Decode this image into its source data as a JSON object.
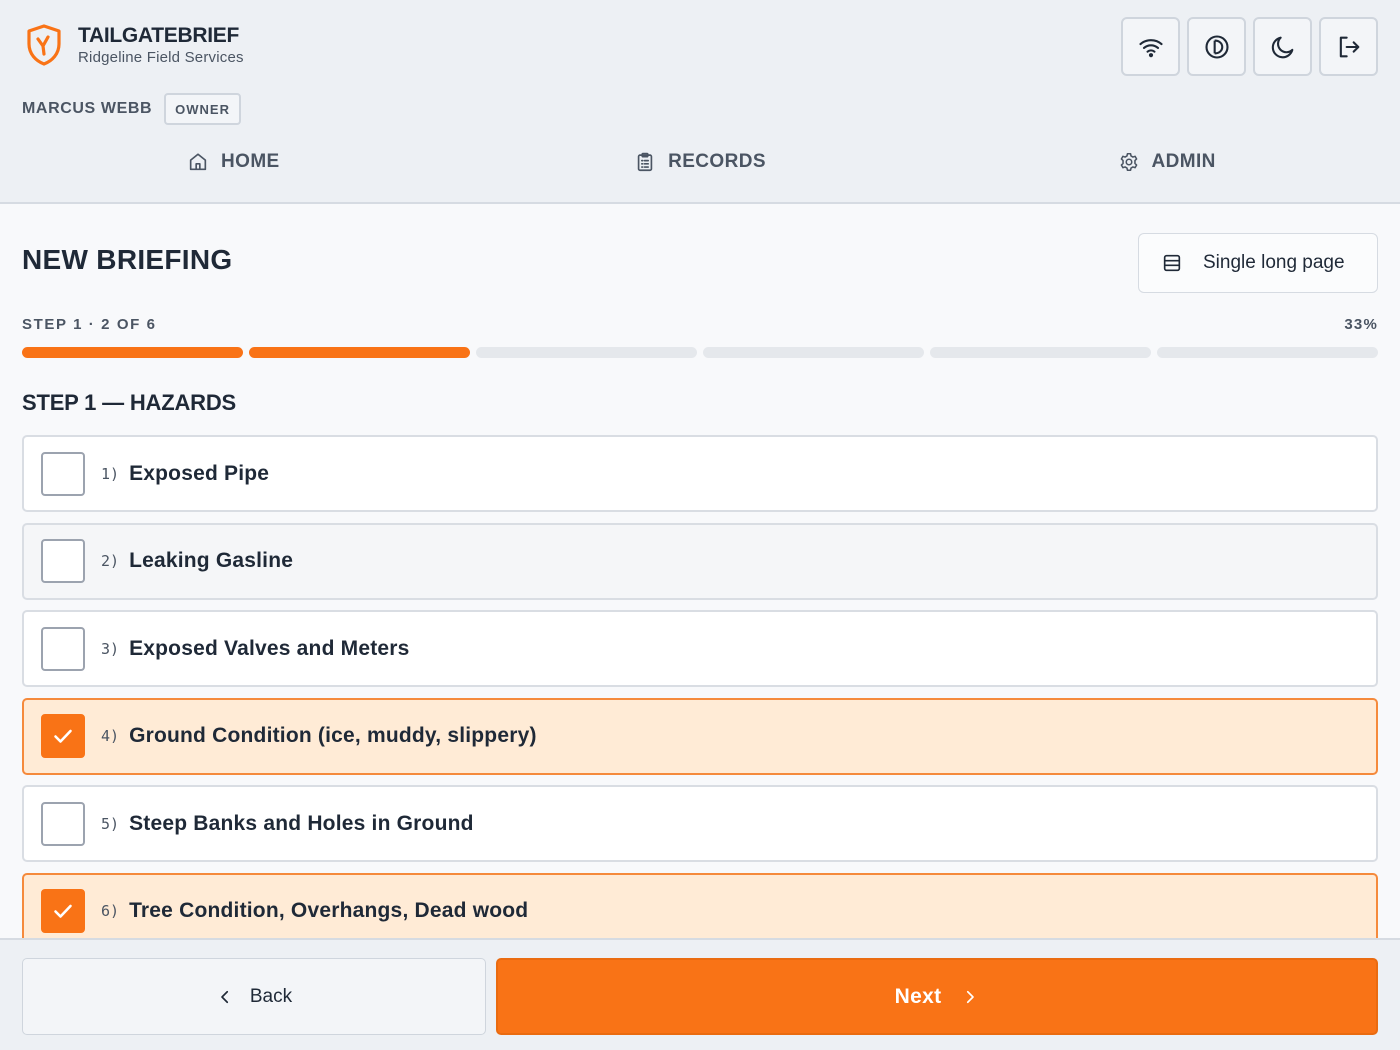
{
  "app": {
    "name": "TAILGATEBRIEF",
    "company": "Ridgeline Field Services",
    "accent": "#f97316"
  },
  "toolbar": {
    "buttons": [
      {
        "icon": "wifi-icon"
      },
      {
        "icon": "contrast-icon"
      },
      {
        "icon": "moon-icon"
      },
      {
        "icon": "logout-icon"
      }
    ]
  },
  "user": {
    "name": "MARCUS WEBB",
    "role": "OWNER"
  },
  "nav": {
    "items": [
      {
        "label": "HOME",
        "icon": "home-icon"
      },
      {
        "label": "RECORDS",
        "icon": "clipboard-icon"
      },
      {
        "label": "ADMIN",
        "icon": "gear-icon"
      }
    ]
  },
  "main": {
    "title": "NEW BRIEFING",
    "view_toggle": "Single long page",
    "progress": {
      "label": "STEP 1 · 2 OF 6",
      "percent_text": "33%",
      "completed_segments": 2,
      "total_segments": 6
    },
    "section_title": "STEP 1 — HAZARDS",
    "hazards": [
      {
        "num": "1)",
        "label": "Exposed Pipe",
        "checked": false
      },
      {
        "num": "2)",
        "label": "Leaking Gasline",
        "checked": false
      },
      {
        "num": "3)",
        "label": "Exposed Valves and Meters",
        "checked": false
      },
      {
        "num": "4)",
        "label": "Ground Condition (ice, muddy, slippery)",
        "checked": true
      },
      {
        "num": "5)",
        "label": "Steep Banks and Holes in Ground",
        "checked": false
      },
      {
        "num": "6)",
        "label": "Tree Condition, Overhangs, Dead wood",
        "checked": true
      }
    ]
  },
  "footer": {
    "back_label": "Back",
    "next_label": "Next"
  }
}
